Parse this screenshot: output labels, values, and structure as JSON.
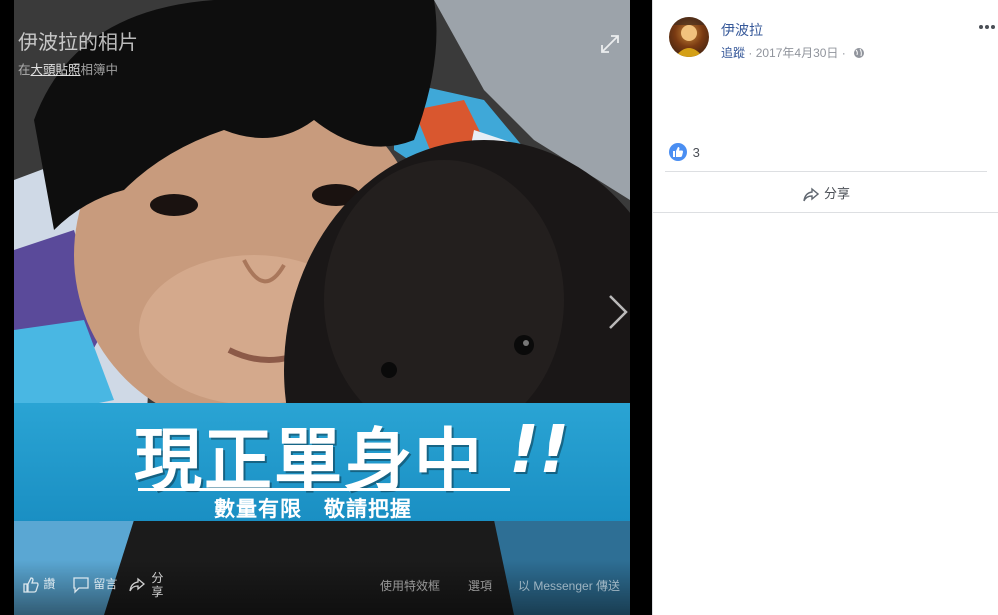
{
  "viewer": {
    "title": "伊波拉的相片",
    "subtitle_prefix": "在",
    "album_link": "大頭貼照",
    "subtitle_suffix": "相簿中",
    "banner_main": "現正單身中",
    "banner_bang": "!!",
    "banner_sub": "數量有限　敬請把握",
    "actions": {
      "like": "讚",
      "comment": "留言",
      "share_top": "分",
      "share_bottom": "享"
    },
    "options": {
      "effects": "使用特效框",
      "options": "選項",
      "messenger": "以 Messenger 傳送"
    }
  },
  "post": {
    "author": "伊波拉",
    "follow": "追蹤",
    "separator": "·",
    "date": "2017年4月30日",
    "separator2": "·",
    "reaction_count": "3",
    "share_label": "分享"
  },
  "colors": {
    "link": "#365899",
    "meta": "#90949c",
    "banner": "#1a8fc3",
    "like_blue": "#4a8ef2"
  }
}
